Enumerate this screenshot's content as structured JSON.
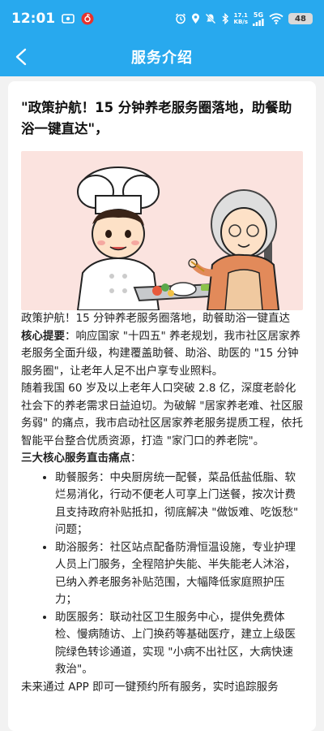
{
  "status_bar": {
    "time": "12:01",
    "network_speed_value": "17.1",
    "network_speed_unit": "KB/s",
    "network_type": "5G",
    "battery": "48"
  },
  "nav": {
    "title": "服务介绍"
  },
  "article": {
    "headline": "\"政策护航！15 分钟养老服务圈落地，助餐助浴一键直达\"，",
    "caption": "政策护航！15 分钟养老服务圈落地，助餐助浴一键直达",
    "summary_label": "核心提要",
    "summary_text": "：响应国家 \"十四五\" 养老规划，我市社区居家养老服务全面升级，构建覆盖助餐、助浴、助医的 \"15 分钟服务圈\"，让老年人足不出户享专业照料。",
    "background_text": "随着我国 60 岁及以上老年人口突破 2.8 亿，深度老龄化社会下的养老需求日益迫切。为破解 \"居家养老难、社区服务弱\" 的痛点，我市启动社区居家养老服务提质工程，依托智能平台整合优质资源，打造 \"家门口的养老院\"。",
    "services_heading": "三大核心服务直击痛点",
    "services_colon": "：",
    "services": [
      {
        "text": "助餐服务：中央厨房统一配餐，菜品低盐低脂、软烂易消化，行动不便老人可享上门送餐，按次计费且支持政府补贴抵扣，彻底解决 \"做饭难、吃饭愁\" 问题；"
      },
      {
        "text": "助浴服务：社区站点配备防滑恒温设施，专业护理人员上门服务，全程陪护失能、半失能老人沐浴，已纳入养老服务补贴范围，大幅降低家庭照护压力；"
      },
      {
        "text": "助医服务：联动社区卫生服务中心，提供免费体检、慢病随访、上门换药等基础医疗，建立上级医院绿色转诊通道，实现 \"小病不出社区，大病快速救治\"。"
      }
    ],
    "footer_text": "未来通过 APP 即可一键预约所有服务，实时追踪服务"
  },
  "colors": {
    "brand": "#28a9ee",
    "card_bg": "#ffffff",
    "page_bg": "#f2f2f2"
  },
  "icons": [
    "screen-record-icon",
    "netease-music-icon",
    "alarm-icon",
    "location-icon",
    "mute-icon",
    "bluetooth-icon",
    "sim-icon",
    "wifi-icon",
    "battery-icon",
    "back-arrow-icon"
  ]
}
